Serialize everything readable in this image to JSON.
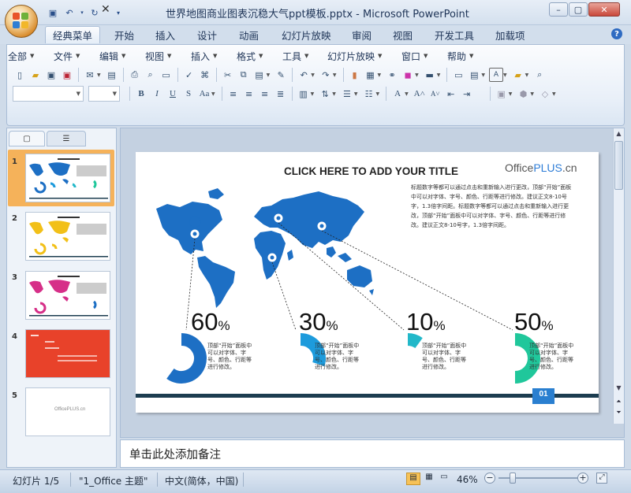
{
  "window": {
    "title": "世界地图商业图表沉稳大气ppt模板.pptx - Microsoft PowerPoint",
    "minimize": "–",
    "maximize": "▢",
    "close": "✕"
  },
  "quick_access": [
    "save-icon",
    "undo-icon",
    "redo-icon",
    "customize-icon"
  ],
  "ribbon_tabs": [
    "经典菜单",
    "开始",
    "插入",
    "设计",
    "动画",
    "幻灯片放映",
    "审阅",
    "视图",
    "开发工具",
    "加载项"
  ],
  "menus": [
    "全部",
    "文件",
    "编辑",
    "视图",
    "插入",
    "格式",
    "工具",
    "幻灯片放映",
    "窗口",
    "帮助"
  ],
  "panel": {
    "tab_slides": "▢",
    "tab_outline": "☰",
    "close": "✕"
  },
  "thumbnails": [
    {
      "num": "1",
      "theme": "#1d6fc4"
    },
    {
      "num": "2",
      "theme": "#f2c018"
    },
    {
      "num": "3",
      "theme": "#d62f88"
    },
    {
      "num": "4",
      "theme": "#e8422a"
    },
    {
      "num": "5",
      "theme": "#ffffff",
      "text": "OfficePLUS.cn"
    }
  ],
  "slide": {
    "title": "CLICK HERE TO ADD YOUR TITLE",
    "brand_prefix": "Office",
    "brand_plus": "PLUS",
    "brand_suffix": ".cn",
    "body": "标题数字等都可以通过点击和重新输入进行更改，顶部“开始”面板中可以对字体、字号、颜色、行距等进行修改。建议正文8-10号字，1.3倍字间距。标题数字等都可以通过点击和重新输入进行更改，顶部“开始”面板中可以对字体、字号、颜色、行距等进行修改。建议正文8-10号字，1.3倍字间距。",
    "stats": [
      {
        "value": "60",
        "unit": "%",
        "fraction": 0.6,
        "color": "#1d6fc4",
        "desc": "顶部“开始”面板中可以对字体、字号、颜色、行距等进行修改。"
      },
      {
        "value": "30",
        "unit": "%",
        "fraction": 0.3,
        "color": "#1d9bdc",
        "desc": "顶部“开始”面板中可以对字体、字号、颜色、行距等进行修改。"
      },
      {
        "value": "10",
        "unit": "%",
        "fraction": 0.1,
        "color": "#22b8c9",
        "desc": "顶部“开始”面板中可以对字体、字号、颜色、行距等进行修改。"
      },
      {
        "value": "50",
        "unit": "%",
        "fraction": 0.5,
        "color": "#20c79b",
        "desc": "顶部“开始”面板中可以对字体、字号、颜色、行距等进行修改。"
      }
    ],
    "page_number": "01",
    "map_color": "#1d6fc4",
    "line_color": "#1c3d50"
  },
  "notes_placeholder": "单击此处添加备注",
  "status": {
    "slide_info": "幻灯片 1/5",
    "theme": "\"1_Office 主题\"",
    "language": "中文(简体，中国)",
    "zoom": "46%",
    "zoom_out": "−",
    "zoom_in": "+"
  }
}
